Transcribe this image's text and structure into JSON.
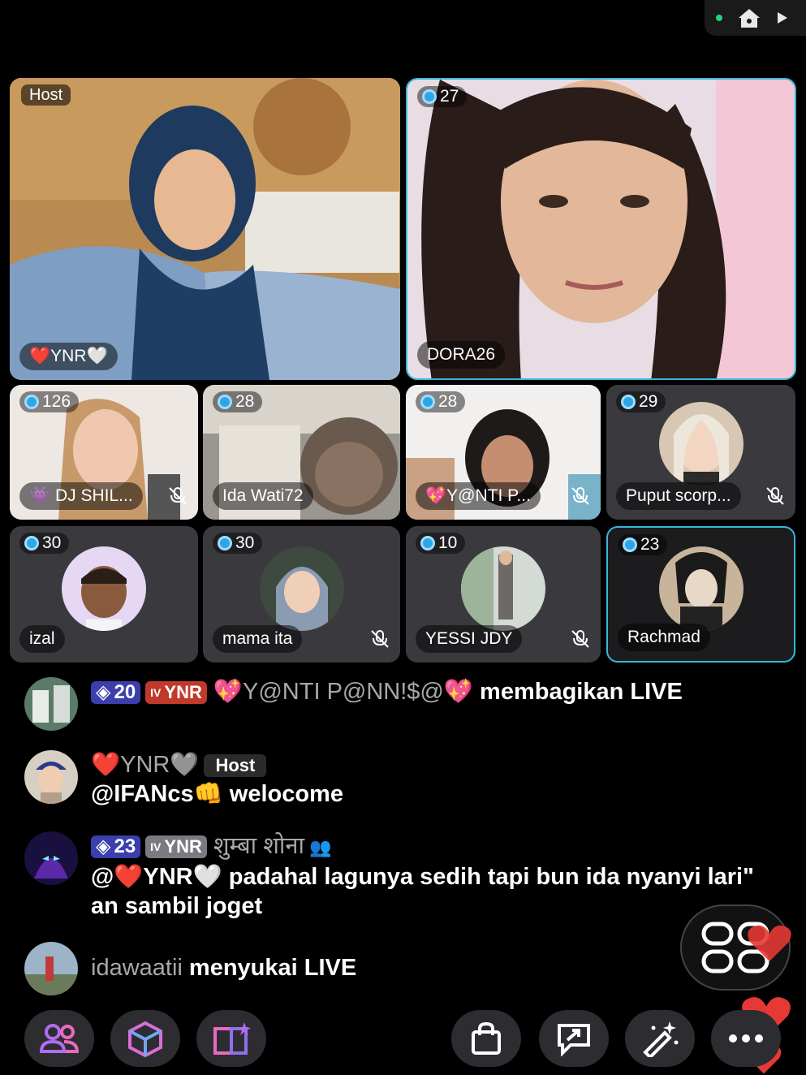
{
  "status": {
    "indicator": "live-dot"
  },
  "host_tile": {
    "host_label": "Host",
    "name": "❤️YNR🤍"
  },
  "featured_tile": {
    "count": "27",
    "name": "DORA26"
  },
  "tiles": [
    {
      "count": "126",
      "name": "👾 DJ SHIL...",
      "muted": true
    },
    {
      "count": "28",
      "name": "Ida Wati72",
      "muted": false
    },
    {
      "count": "28",
      "name": "💖Y@NTI P...",
      "muted": true
    },
    {
      "count": "29",
      "name": "Puput scorp...",
      "muted": true
    },
    {
      "count": "30",
      "name": "izal",
      "muted": false
    },
    {
      "count": "30",
      "name": "mama ita",
      "muted": true
    },
    {
      "count": "10",
      "name": "YESSI JDY",
      "muted": true
    },
    {
      "count": "23",
      "name": "Rachmad",
      "muted": false
    }
  ],
  "comments": [
    {
      "level": "20",
      "fan_badge": "YNR",
      "fan_tier": "IV",
      "user": "💖Y@NTI P@NN!$@💖",
      "text": "membagikan LIVE"
    },
    {
      "user": "❤️YNR🩶",
      "host_badge": "Host",
      "text": "@IFANcs👊 welocome"
    },
    {
      "level": "23",
      "fan_badge": "YNR",
      "fan_tier": "IV",
      "user": "शुम्बा शोना",
      "text": "@❤️YNR🤍 padahal lagunya sedih tapi bun ida nyanyi lari\" an sambil joget"
    },
    {
      "user": "idawaatii",
      "text": "menyukai LIVE"
    }
  ],
  "toolbar": {
    "left": [
      "people-icon",
      "cube-icon",
      "book-star-icon"
    ],
    "right": [
      "shopping-bag-icon",
      "share-chat-icon",
      "magic-wand-icon",
      "more-icon"
    ]
  },
  "colors": {
    "accent": "#3ab6d8",
    "level_badge": "#3b3fae",
    "fan_badge": "#c0392b",
    "heart": "#e53935"
  }
}
